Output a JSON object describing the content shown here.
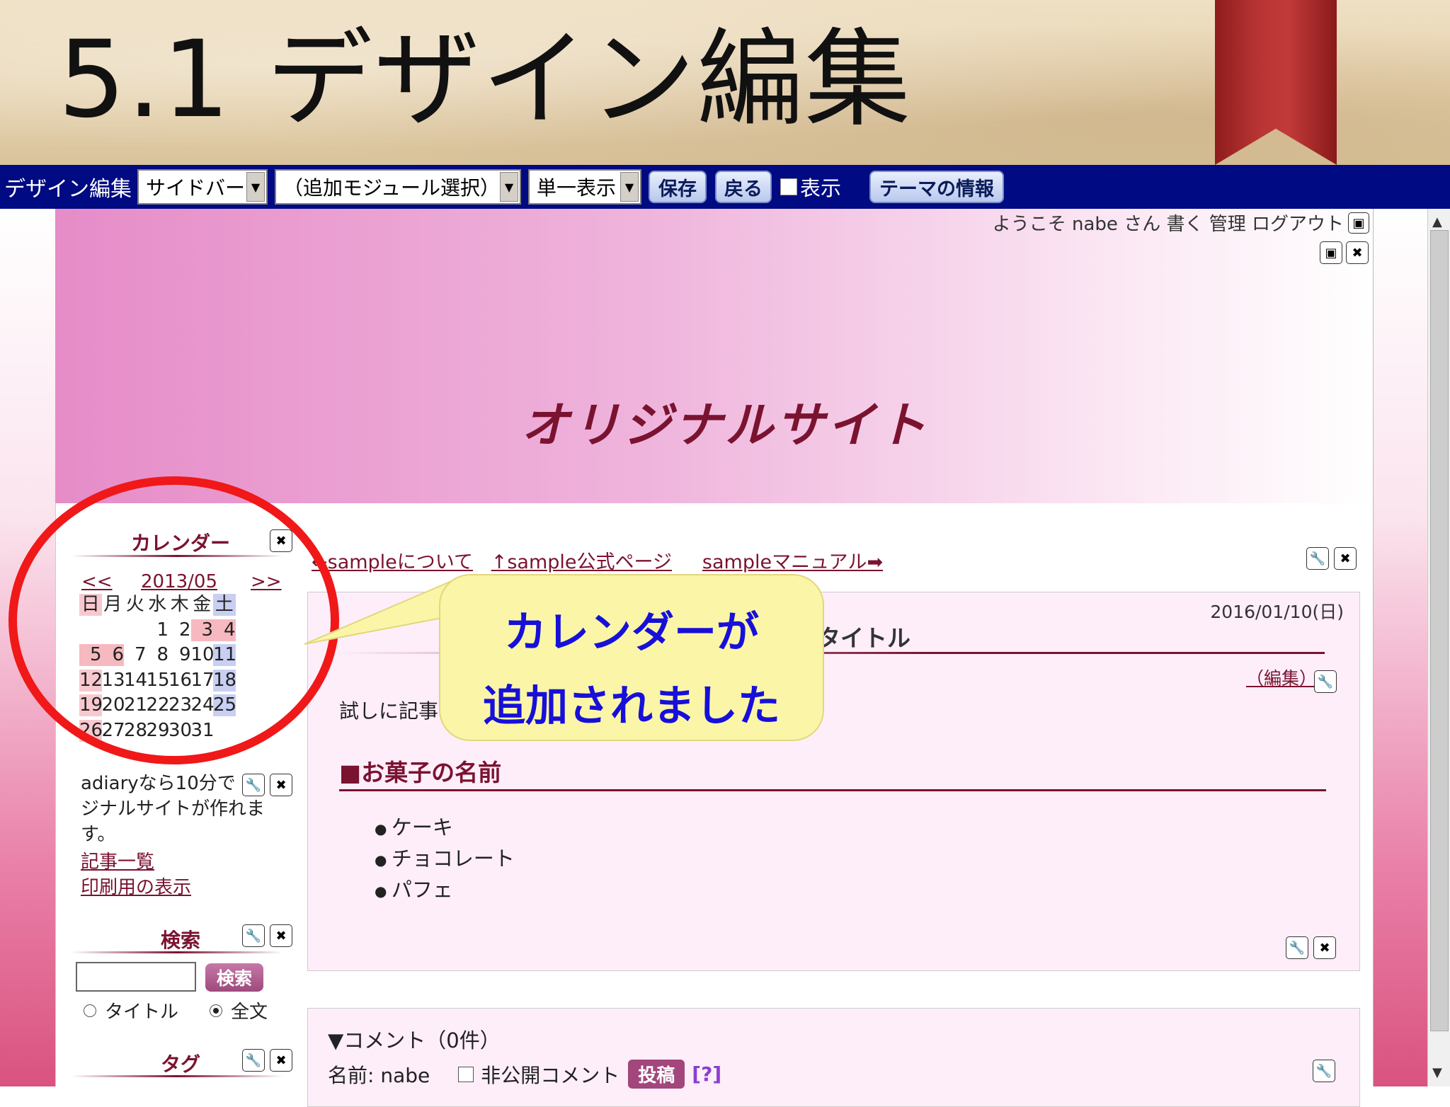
{
  "slide": {
    "title": "5.1 デザイン編集"
  },
  "toolbar": {
    "label": "デザイン編集",
    "select_area": "サイドバー",
    "select_module": "（追加モジュール選択）",
    "select_view": "単一表示",
    "save_label": "保存",
    "back_label": "戻る",
    "show_label": "表示",
    "theme_info_label": "テーマの情報"
  },
  "site": {
    "welcome": "ようこそ nabe さん 書く 管理 ログアウト",
    "banner_title": "オリジナルサイト"
  },
  "sidebar": {
    "calendar": {
      "heading": "カレンダー",
      "prev": "<<",
      "month": "2013/05",
      "next": ">>",
      "weekdays": [
        "日",
        "月",
        "火",
        "水",
        "木",
        "金",
        "土"
      ],
      "weeks": [
        [
          "",
          "",
          "",
          "1",
          "2",
          "3",
          "4"
        ],
        [
          "5",
          "6",
          "7",
          "8",
          "9",
          "10",
          "11"
        ],
        [
          "12",
          "13",
          "14",
          "15",
          "16",
          "17",
          "18"
        ],
        [
          "19",
          "20",
          "21",
          "22",
          "23",
          "24",
          "25"
        ],
        [
          "26",
          "27",
          "28",
          "29",
          "30",
          "31",
          ""
        ]
      ]
    },
    "description_line1": "adiaryなら10分で",
    "description_line2": "ジナルサイトが作れま",
    "description_line3": "す。",
    "link_articles": "記事一覧",
    "link_print": "印刷用の表示",
    "search": {
      "heading": "検索",
      "button": "検索",
      "radio_title": "タイトル",
      "radio_full": "全文"
    },
    "tag": {
      "heading": "タグ"
    }
  },
  "main": {
    "nav_about": "←sampleについて",
    "nav_official": "↑sample公式ページ",
    "nav_manual": "sampleマニュアル➡",
    "article": {
      "date": "2016/01/10(日)",
      "title": "記事のタイトル",
      "edit": "（編集）",
      "body": "試しに記事を書いてみます。",
      "section_heading": "■お菓子の名前",
      "items": [
        "ケーキ",
        "チョコレート",
        "パフェ"
      ]
    },
    "comments": {
      "heading": "▼コメント（0件）",
      "name_label": "名前: nabe",
      "private_label": "非公開コメント",
      "post_button": "投稿",
      "help": "[?]"
    }
  },
  "annotation": {
    "line1": "カレンダーが",
    "line2": "追加されました"
  },
  "colors": {
    "toolbar_bg": "#000a82",
    "accent": "#7a1330",
    "callout_text": "#1710d8",
    "callout_bg": "#fbf5a8",
    "highlight_ring": "#f01818"
  }
}
